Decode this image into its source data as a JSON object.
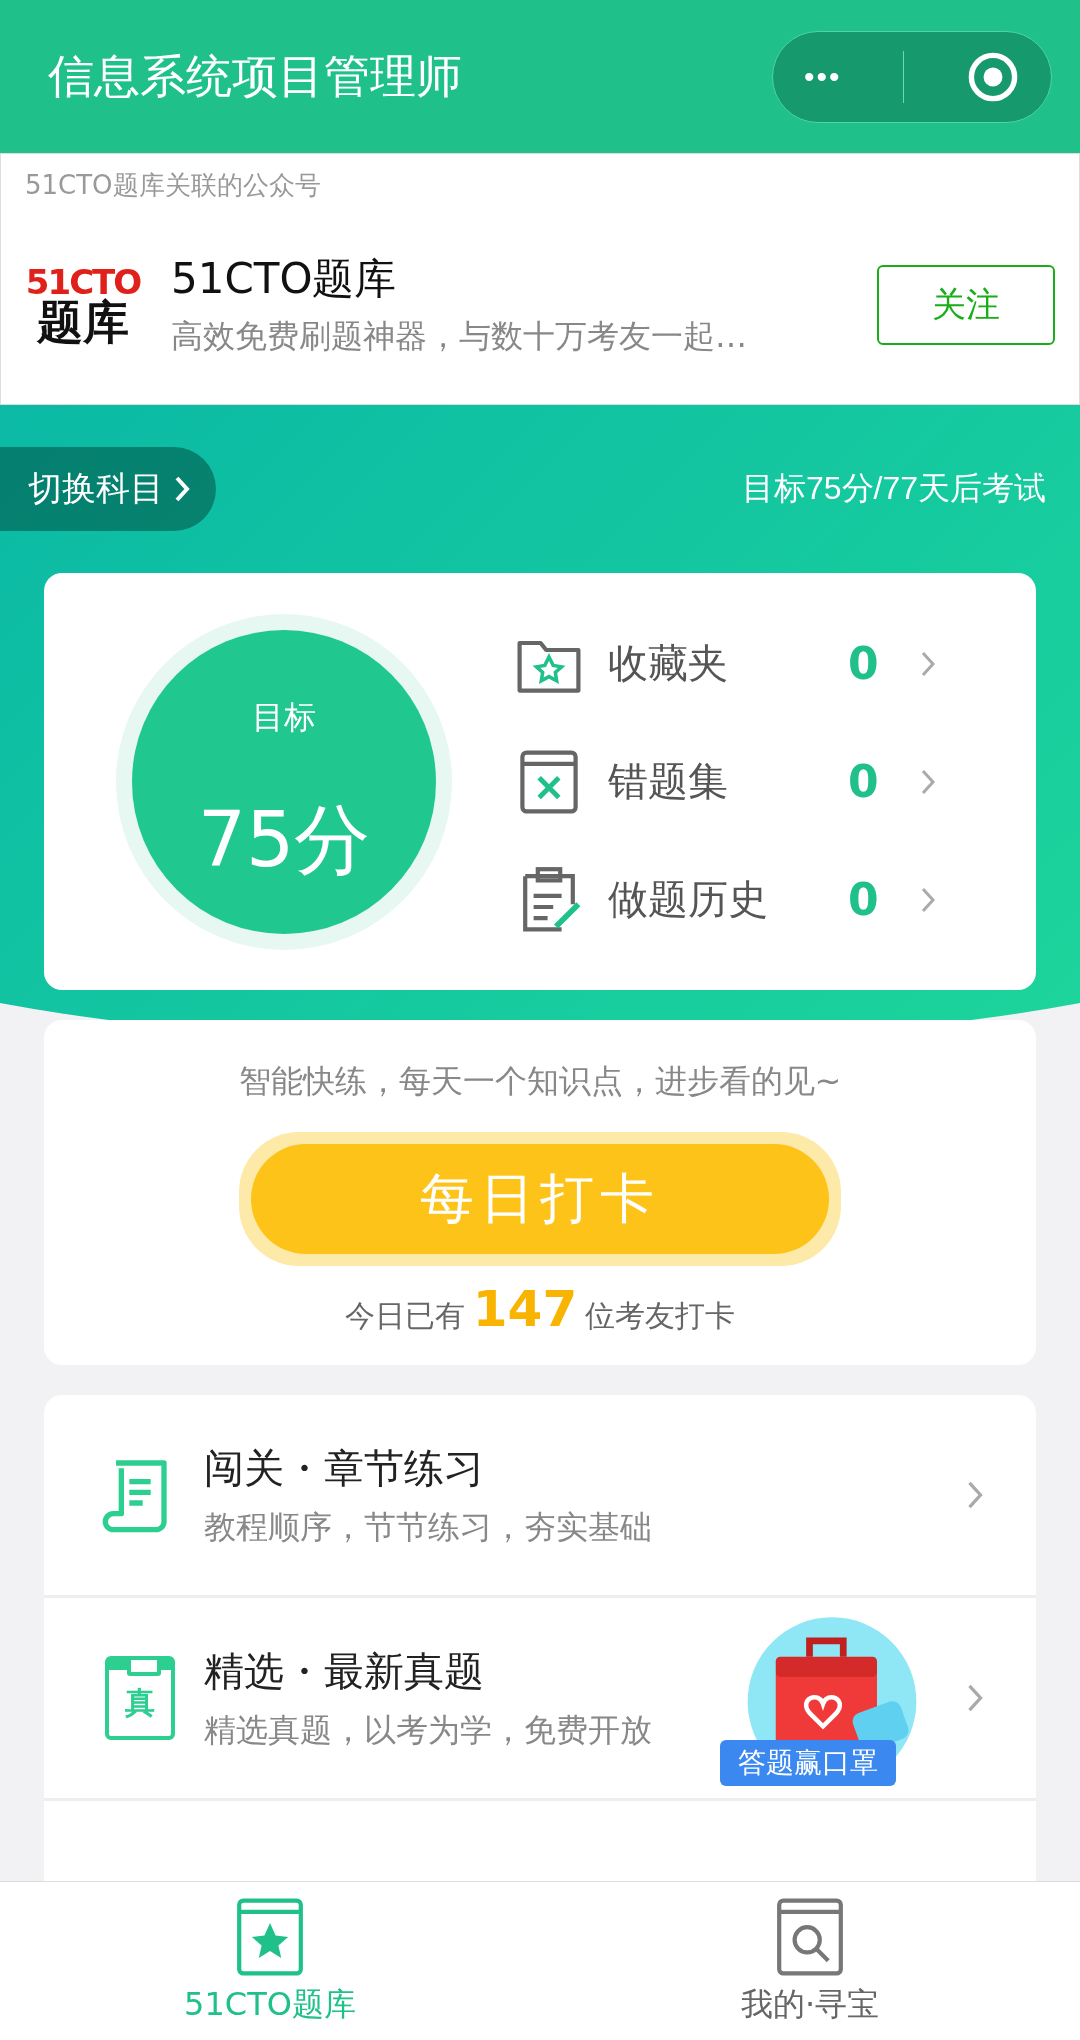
{
  "header": {
    "title": "信息系统项目管理师",
    "menu": "•••"
  },
  "account": {
    "caption": "51CTO题库关联的公众号",
    "logo_top": "51CTO",
    "logo_bottom": "题库",
    "name": "51CTO题库",
    "desc": "高效免费刷题神器，与数十万考友一起…",
    "follow": "关注"
  },
  "subject": {
    "switch": "切换科目",
    "goal": "目标75分/77天后考试"
  },
  "target": {
    "label": "目标",
    "score": "75分"
  },
  "stats": [
    {
      "kind": "favorite",
      "label": "收藏夹",
      "count": "0"
    },
    {
      "kind": "wrong",
      "label": "错题集",
      "count": "0"
    },
    {
      "kind": "history",
      "label": "做题历史",
      "count": "0"
    }
  ],
  "daily": {
    "hint": "智能快练，每天一个知识点，进步看的见~",
    "button": "每日打卡",
    "prefix": "今日已有",
    "count": "147",
    "suffix": "位考友打卡"
  },
  "practice": [
    {
      "kind": "chapter",
      "title": "闯关・章节练习",
      "desc": "教程顺序，节节练习，夯实基础"
    },
    {
      "kind": "real",
      "icon_text": "真",
      "title": "精选・最新真题",
      "desc": "精选真题，以考为学，免费开放",
      "promo": "答题赢口罩"
    }
  ],
  "tabs": [
    {
      "kind": "bank",
      "label": "51CTO题库",
      "selected": true
    },
    {
      "kind": "search",
      "label": "我的·寻宝",
      "selected": false
    }
  ]
}
